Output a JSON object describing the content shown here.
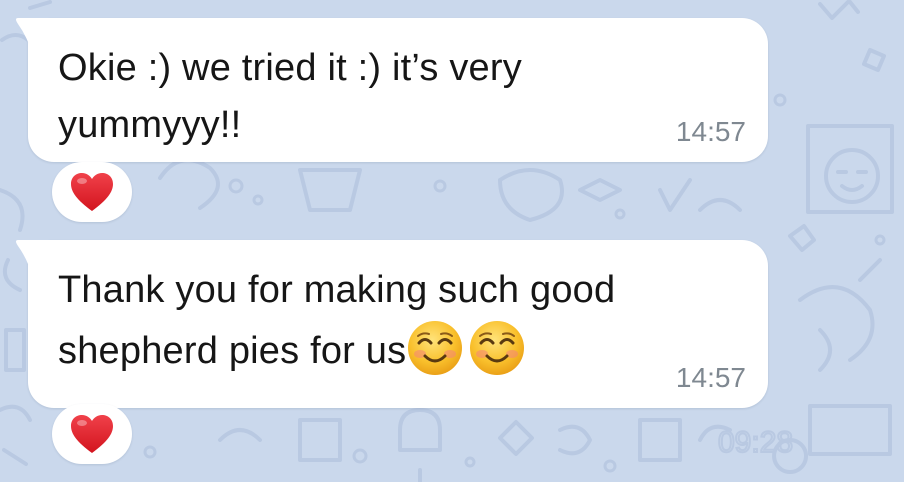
{
  "messages": [
    {
      "text": "Okie :) we tried it :) it’s very yummyyy!!",
      "time": "14:57",
      "reaction": "heart-icon"
    },
    {
      "text": "Thank you for making such good shepherd pies for us",
      "emojis": [
        "smiling-face-with-smiling-eyes-icon",
        "smiling-face-with-smiling-eyes-icon"
      ],
      "time": "14:57",
      "reaction": "heart-icon"
    }
  ],
  "wallpaper_doodle_text": "09:28",
  "colors": {
    "background": "#cad8ec",
    "bubble": "#ffffff",
    "message_text": "#161616",
    "time_text": "#7f8891",
    "heart": "#e0222b",
    "emoji_face": "#f9c02c"
  }
}
